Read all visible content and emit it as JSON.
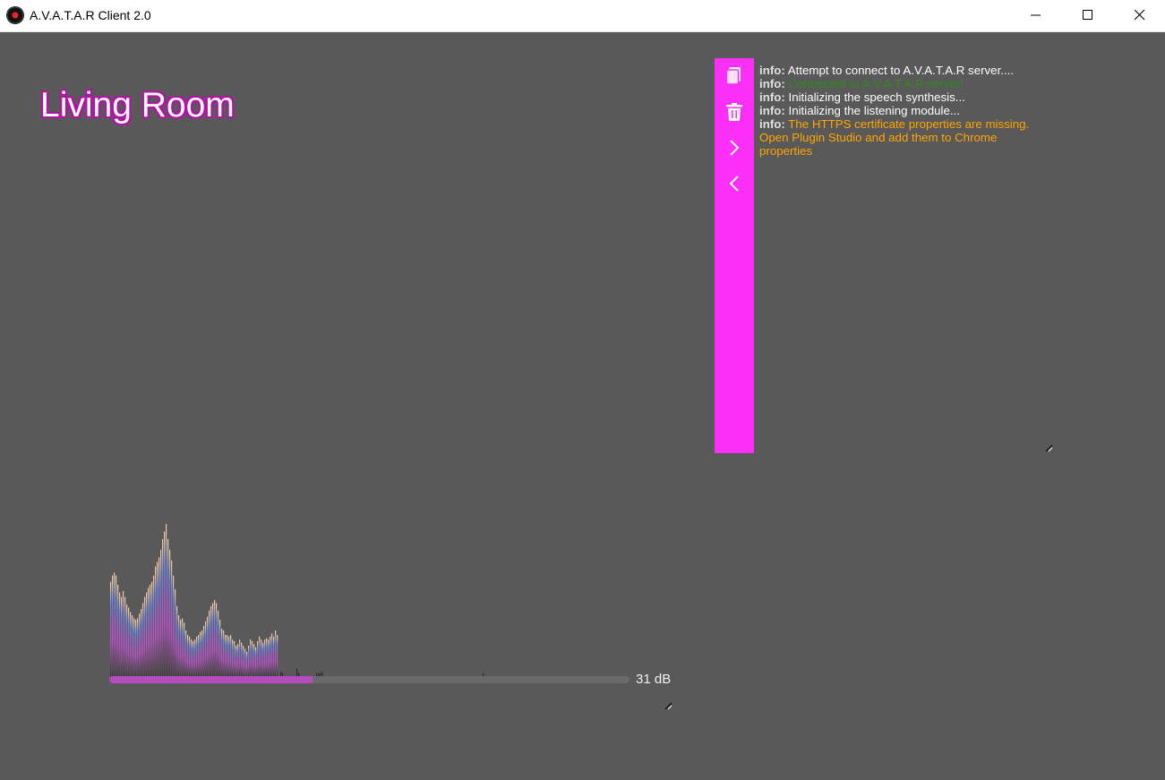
{
  "window": {
    "title": "A.V.A.T.A.R Client 2.0",
    "controls": [
      "minimize",
      "maximize",
      "close"
    ]
  },
  "room": {
    "name": "Living Room"
  },
  "log_toolbar": {
    "color": "#fb2ff7",
    "icons": [
      "copy-icon",
      "trash-icon",
      "chevron-right-icon",
      "chevron-left-icon"
    ]
  },
  "log": {
    "entries": [
      {
        "label": "info:",
        "message": "Attempt to connect to A.V.A.T.A.R server....",
        "color": "#ffffff"
      },
      {
        "label": "info:",
        "message": "Connected to A.V.A.T.A.R server!",
        "color": "#2e8b1c"
      },
      {
        "label": "info:",
        "message": "Initializing the speech synthesis...",
        "color": "#ffffff"
      },
      {
        "label": "info:",
        "message": "Initializing the listening module...",
        "color": "#ffffff"
      },
      {
        "label": "info:",
        "message": "The HTTPS certificate properties are missing. Open Plugin Studio and add them to Chrome properties",
        "color": "#ffa500"
      }
    ]
  },
  "audio": {
    "level_label": "31 dB",
    "level_fraction": 0.39,
    "spectrum": [
      0.62,
      0.66,
      0.68,
      0.66,
      0.6,
      0.55,
      0.52,
      0.56,
      0.52,
      0.47,
      0.45,
      0.42,
      0.4,
      0.38,
      0.37,
      0.38,
      0.41,
      0.44,
      0.48,
      0.52,
      0.55,
      0.58,
      0.6,
      0.62,
      0.66,
      0.72,
      0.75,
      0.78,
      0.83,
      0.9,
      0.95,
      1.0,
      0.9,
      0.83,
      0.76,
      0.66,
      0.57,
      0.46,
      0.4,
      0.37,
      0.38,
      0.35,
      0.3,
      0.27,
      0.26,
      0.24,
      0.23,
      0.24,
      0.26,
      0.27,
      0.29,
      0.3,
      0.33,
      0.36,
      0.39,
      0.43,
      0.46,
      0.48,
      0.5,
      0.48,
      0.43,
      0.37,
      0.31,
      0.3,
      0.27,
      0.27,
      0.26,
      0.27,
      0.24,
      0.23,
      0.2,
      0.21,
      0.24,
      0.22,
      0.2,
      0.18,
      0.16,
      0.2,
      0.24,
      0.23,
      0.21,
      0.19,
      0.23,
      0.26,
      0.24,
      0.22,
      0.24,
      0.25,
      0.24,
      0.26,
      0.28,
      0.26,
      0.3,
      0.27,
      0.0,
      0.03,
      0.02,
      0.0,
      0.0,
      0.0,
      0.0,
      0.0,
      0.0,
      0.0,
      0.05,
      0.02,
      0.0,
      0.0,
      0.0,
      0.0,
      0.0,
      0.0,
      0.0,
      0.0,
      0.0,
      0.02,
      0.02,
      0.02
    ],
    "tail_marks": [
      0.03,
      0.0,
      0.0,
      0.0,
      0.0,
      0.0,
      0.0,
      0.0,
      0.0,
      0.0,
      0.0,
      0.0,
      0.0,
      0.0,
      0.0,
      0.0,
      0.0,
      0.0,
      0.0,
      0.0,
      0.0,
      0.0,
      0.0,
      0.0,
      0.0,
      0.0,
      0.0,
      0.0,
      0.0,
      0.0,
      0.0,
      0.0,
      0.0,
      0.0,
      0.0,
      0.0,
      0.0,
      0.0,
      0.0,
      0.0,
      0.0,
      0.0,
      0.0,
      0.0,
      0.0,
      0.0,
      0.0,
      0.0,
      0.0,
      0.0,
      0.0,
      0.0,
      0.0,
      0.0,
      0.0,
      0.0,
      0.0,
      0.0,
      0.0,
      0.0,
      0.0,
      0.0,
      0.0,
      0.0,
      0.0,
      0.0,
      0.0,
      0.0,
      0.0,
      0.0,
      0.0,
      0.0,
      0.0,
      0.0,
      0.0,
      0.0,
      0.0,
      0.0,
      0.0,
      0.0,
      0.0,
      0.0,
      0.0,
      0.0,
      0.0,
      0.0,
      0.0,
      0.0,
      0.0,
      0.0,
      0.02,
      0.0
    ],
    "colors": {
      "bottom": "#3a3a3a",
      "mid": "#c050d0",
      "upper": "#6a88e0",
      "peak": "#f0c8a8"
    }
  }
}
